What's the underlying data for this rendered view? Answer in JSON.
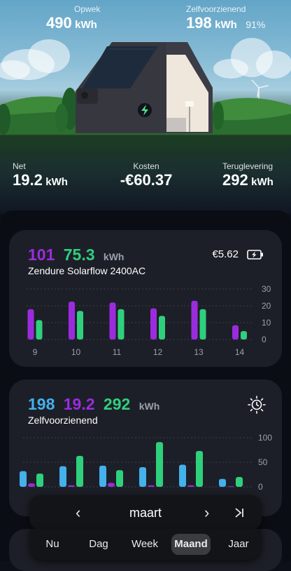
{
  "hero": {
    "production": {
      "label": "Opwek",
      "value": "490",
      "unit": "kWh"
    },
    "self_sufficient": {
      "label": "Zelfvoorzienend",
      "value": "198",
      "unit": "kWh",
      "percent": "91%"
    },
    "net": {
      "label": "Net",
      "value": "19.2",
      "unit": "kWh"
    },
    "costs": {
      "label": "Kosten",
      "value": "-€60.37"
    },
    "feed_in": {
      "label": "Teruglevering",
      "value": "292",
      "unit": "kWh"
    }
  },
  "battery_card": {
    "value_purple": "101",
    "value_green": "75.3",
    "unit": "kWh",
    "device": "Zendure Solarflow 2400AC",
    "savings": "€5.62",
    "icon": "battery-charging-icon",
    "colors": {
      "purple": "#9b2cde",
      "green": "#2fd07c"
    }
  },
  "self_card": {
    "value_blue": "198",
    "value_purple": "19.2",
    "value_green": "292",
    "unit": "kWh",
    "title": "Zelfvoorzienend",
    "icon": "sun-clock-icon",
    "colors": {
      "blue": "#44b0ec",
      "purple": "#9b2cde",
      "green": "#2fd07c"
    }
  },
  "nav": {
    "month": "maart",
    "prev_icon": "chevron-left-icon",
    "next_icon": "chevron-right-icon",
    "last_icon": "skip-to-end-icon"
  },
  "tabs": [
    {
      "label": "Nu"
    },
    {
      "label": "Dag"
    },
    {
      "label": "Week"
    },
    {
      "label": "Maand",
      "active": true
    },
    {
      "label": "Jaar"
    }
  ],
  "chart_data": [
    {
      "type": "bar",
      "categories": [
        "9",
        "10",
        "11",
        "12",
        "13",
        "14"
      ],
      "series": [
        {
          "color": "#9b2cde",
          "values": [
            18,
            22.5,
            22,
            18.5,
            23,
            8.5
          ]
        },
        {
          "color": "#2fd07c",
          "values": [
            11.5,
            17,
            18,
            14,
            18,
            5
          ]
        }
      ],
      "yticks": [
        0,
        10,
        20,
        30
      ],
      "ylim": [
        0,
        30
      ]
    },
    {
      "type": "bar",
      "categories": [],
      "series": [
        {
          "color": "#44b0ec",
          "values": [
            32,
            42,
            43,
            40,
            45,
            16
          ]
        },
        {
          "color": "#9b2cde",
          "values": [
            7,
            3,
            8,
            3,
            3,
            1
          ]
        },
        {
          "color": "#2fd07c",
          "values": [
            27,
            63,
            34,
            91,
            73,
            20
          ]
        }
      ],
      "yticks": [
        0,
        50,
        100
      ],
      "ylim": [
        0,
        100
      ]
    }
  ]
}
